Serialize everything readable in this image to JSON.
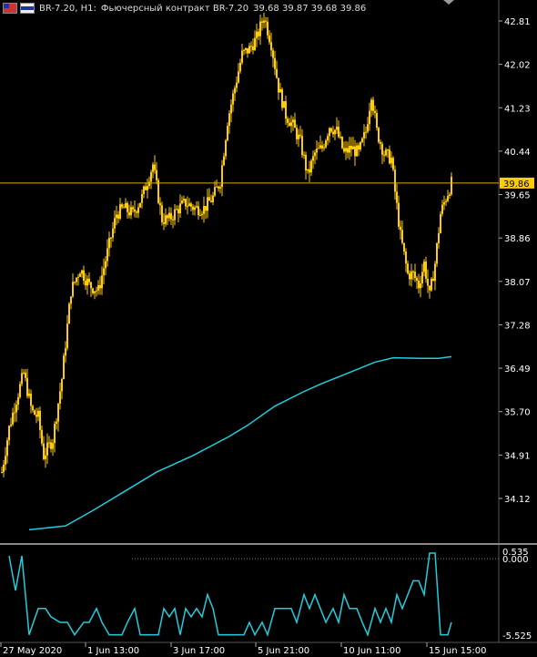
{
  "header": {
    "symbol": "BR-7.20, H1:",
    "instrument": "Фьючерсный контракт BR-7.20",
    "ohlc": "39.68 39.87 39.68 39.86",
    "flag1_icon": "window-flag-icon",
    "flag2_icon": "window-flag-icon"
  },
  "colors": {
    "background": "#000000",
    "candle": "#ffcc00",
    "ma_line": "#22ccdd",
    "price_line": "#d9b000",
    "price_label_bg": "#ffcc00",
    "axis_text": "#ffffff",
    "separator": "#888888"
  },
  "chart_data": [
    {
      "type": "candlestick",
      "title": "BR-7.20, H1",
      "y_ticks": [
        "42.81",
        "42.02",
        "41.23",
        "40.44",
        "39.65",
        "38.86",
        "38.07",
        "37.28",
        "36.49",
        "35.70",
        "34.91",
        "34.12"
      ],
      "ylim": [
        33.55,
        43.0
      ],
      "current_price": 39.86,
      "current_price_label": "39.86",
      "x_ticks": [
        "27 May 2020",
        "1 Jun 13:00",
        "3 Jun 17:00",
        "5 Jun 21:00",
        "10 Jun 11:00",
        "15 Jun 15:00"
      ],
      "price_series": [
        {
          "idx": 0,
          "v": 34.6
        },
        {
          "idx": 8,
          "v": 35.4
        },
        {
          "idx": 14,
          "v": 35.8
        },
        {
          "idx": 24,
          "v": 36.4
        },
        {
          "idx": 33,
          "v": 35.7
        },
        {
          "idx": 40,
          "v": 35.6
        },
        {
          "idx": 46,
          "v": 34.9
        },
        {
          "idx": 56,
          "v": 35.2
        },
        {
          "idx": 66,
          "v": 36.3
        },
        {
          "idx": 76,
          "v": 37.9
        },
        {
          "idx": 86,
          "v": 38.3
        },
        {
          "idx": 96,
          "v": 38.0
        },
        {
          "idx": 106,
          "v": 37.9
        },
        {
          "idx": 116,
          "v": 38.6
        },
        {
          "idx": 126,
          "v": 39.3
        },
        {
          "idx": 134,
          "v": 39.4
        },
        {
          "idx": 144,
          "v": 39.3
        },
        {
          "idx": 154,
          "v": 39.6
        },
        {
          "idx": 166,
          "v": 40.2
        },
        {
          "idx": 176,
          "v": 39.2
        },
        {
          "idx": 184,
          "v": 39.2
        },
        {
          "idx": 194,
          "v": 39.4
        },
        {
          "idx": 202,
          "v": 39.5
        },
        {
          "idx": 212,
          "v": 39.4
        },
        {
          "idx": 222,
          "v": 39.4
        },
        {
          "idx": 232,
          "v": 39.6
        },
        {
          "idx": 240,
          "v": 39.9
        },
        {
          "idx": 248,
          "v": 41.0
        },
        {
          "idx": 256,
          "v": 41.6
        },
        {
          "idx": 264,
          "v": 42.2
        },
        {
          "idx": 272,
          "v": 42.3
        },
        {
          "idx": 280,
          "v": 42.5
        },
        {
          "idx": 288,
          "v": 42.9
        },
        {
          "idx": 296,
          "v": 42.4
        },
        {
          "idx": 304,
          "v": 41.6
        },
        {
          "idx": 312,
          "v": 41.1
        },
        {
          "idx": 320,
          "v": 40.9
        },
        {
          "idx": 328,
          "v": 40.6
        },
        {
          "idx": 336,
          "v": 40.0
        },
        {
          "idx": 344,
          "v": 40.4
        },
        {
          "idx": 352,
          "v": 40.5
        },
        {
          "idx": 360,
          "v": 40.9
        },
        {
          "idx": 368,
          "v": 40.8
        },
        {
          "idx": 376,
          "v": 40.4
        },
        {
          "idx": 384,
          "v": 40.5
        },
        {
          "idx": 392,
          "v": 40.4
        },
        {
          "idx": 400,
          "v": 40.8
        },
        {
          "idx": 406,
          "v": 41.5
        },
        {
          "idx": 412,
          "v": 40.8
        },
        {
          "idx": 420,
          "v": 40.4
        },
        {
          "idx": 428,
          "v": 40.3
        },
        {
          "idx": 432,
          "v": 39.7
        },
        {
          "idx": 438,
          "v": 38.9
        },
        {
          "idx": 446,
          "v": 38.2
        },
        {
          "idx": 452,
          "v": 38.2
        },
        {
          "idx": 458,
          "v": 38.0
        },
        {
          "idx": 464,
          "v": 38.4
        },
        {
          "idx": 470,
          "v": 37.8
        },
        {
          "idx": 476,
          "v": 38.4
        },
        {
          "idx": 482,
          "v": 39.3
        },
        {
          "idx": 488,
          "v": 39.6
        },
        {
          "idx": 494,
          "v": 39.86
        }
      ],
      "ma_series": [
        {
          "idx": 30,
          "v": 33.55
        },
        {
          "idx": 70,
          "v": 33.62
        },
        {
          "idx": 100,
          "v": 33.9
        },
        {
          "idx": 130,
          "v": 34.2
        },
        {
          "idx": 170,
          "v": 34.6
        },
        {
          "idx": 210,
          "v": 34.9
        },
        {
          "idx": 250,
          "v": 35.25
        },
        {
          "idx": 270,
          "v": 35.45
        },
        {
          "idx": 300,
          "v": 35.8
        },
        {
          "idx": 330,
          "v": 36.05
        },
        {
          "idx": 350,
          "v": 36.2
        },
        {
          "idx": 380,
          "v": 36.4
        },
        {
          "idx": 410,
          "v": 36.6
        },
        {
          "idx": 430,
          "v": 36.68
        },
        {
          "idx": 460,
          "v": 36.67
        },
        {
          "idx": 480,
          "v": 36.67
        },
        {
          "idx": 494,
          "v": 36.7
        }
      ]
    },
    {
      "type": "line",
      "title": "",
      "y_ticks": [
        "0.535",
        "0.000",
        "-5.525"
      ],
      "ylim": [
        -5.525,
        0.535
      ],
      "series": [
        {
          "idx": 8,
          "v": 0.2
        },
        {
          "idx": 15,
          "v": -2.3
        },
        {
          "idx": 22,
          "v": 0.2
        },
        {
          "idx": 30,
          "v": -5.5
        },
        {
          "idx": 40,
          "v": -3.6
        },
        {
          "idx": 48,
          "v": -3.6
        },
        {
          "idx": 54,
          "v": -4.2
        },
        {
          "idx": 64,
          "v": -4.6
        },
        {
          "idx": 72,
          "v": -4.6
        },
        {
          "idx": 80,
          "v": -5.5
        },
        {
          "idx": 90,
          "v": -4.6
        },
        {
          "idx": 96,
          "v": -4.6
        },
        {
          "idx": 104,
          "v": -3.6
        },
        {
          "idx": 110,
          "v": -4.6
        },
        {
          "idx": 118,
          "v": -5.5
        },
        {
          "idx": 132,
          "v": -5.5
        },
        {
          "idx": 138,
          "v": -4.6
        },
        {
          "idx": 146,
          "v": -3.6
        },
        {
          "idx": 152,
          "v": -5.5
        },
        {
          "idx": 172,
          "v": -5.5
        },
        {
          "idx": 178,
          "v": -3.6
        },
        {
          "idx": 184,
          "v": -4.2
        },
        {
          "idx": 190,
          "v": -3.6
        },
        {
          "idx": 196,
          "v": -5.5
        },
        {
          "idx": 202,
          "v": -3.6
        },
        {
          "idx": 208,
          "v": -4.2
        },
        {
          "idx": 214,
          "v": -3.6
        },
        {
          "idx": 220,
          "v": -4.2
        },
        {
          "idx": 226,
          "v": -2.6
        },
        {
          "idx": 232,
          "v": -3.6
        },
        {
          "idx": 238,
          "v": -5.5
        },
        {
          "idx": 266,
          "v": -5.5
        },
        {
          "idx": 272,
          "v": -4.6
        },
        {
          "idx": 278,
          "v": -5.5
        },
        {
          "idx": 286,
          "v": -4.6
        },
        {
          "idx": 292,
          "v": -5.5
        },
        {
          "idx": 300,
          "v": -3.6
        },
        {
          "idx": 318,
          "v": -3.6
        },
        {
          "idx": 324,
          "v": -4.6
        },
        {
          "idx": 332,
          "v": -2.6
        },
        {
          "idx": 338,
          "v": -3.6
        },
        {
          "idx": 344,
          "v": -2.6
        },
        {
          "idx": 350,
          "v": -3.6
        },
        {
          "idx": 356,
          "v": -4.6
        },
        {
          "idx": 364,
          "v": -3.6
        },
        {
          "idx": 370,
          "v": -4.6
        },
        {
          "idx": 376,
          "v": -2.6
        },
        {
          "idx": 382,
          "v": -3.6
        },
        {
          "idx": 390,
          "v": -3.6
        },
        {
          "idx": 396,
          "v": -4.6
        },
        {
          "idx": 402,
          "v": -5.5
        },
        {
          "idx": 410,
          "v": -3.6
        },
        {
          "idx": 416,
          "v": -4.6
        },
        {
          "idx": 422,
          "v": -3.6
        },
        {
          "idx": 428,
          "v": -4.6
        },
        {
          "idx": 434,
          "v": -2.6
        },
        {
          "idx": 440,
          "v": -3.6
        },
        {
          "idx": 446,
          "v": -2.6
        },
        {
          "idx": 452,
          "v": -1.6
        },
        {
          "idx": 458,
          "v": -1.6
        },
        {
          "idx": 464,
          "v": -2.6
        },
        {
          "idx": 470,
          "v": 0.4
        },
        {
          "idx": 476,
          "v": 0.4
        },
        {
          "idx": 482,
          "v": -5.5
        },
        {
          "idx": 490,
          "v": -5.5
        },
        {
          "idx": 494,
          "v": -4.6
        }
      ]
    }
  ]
}
